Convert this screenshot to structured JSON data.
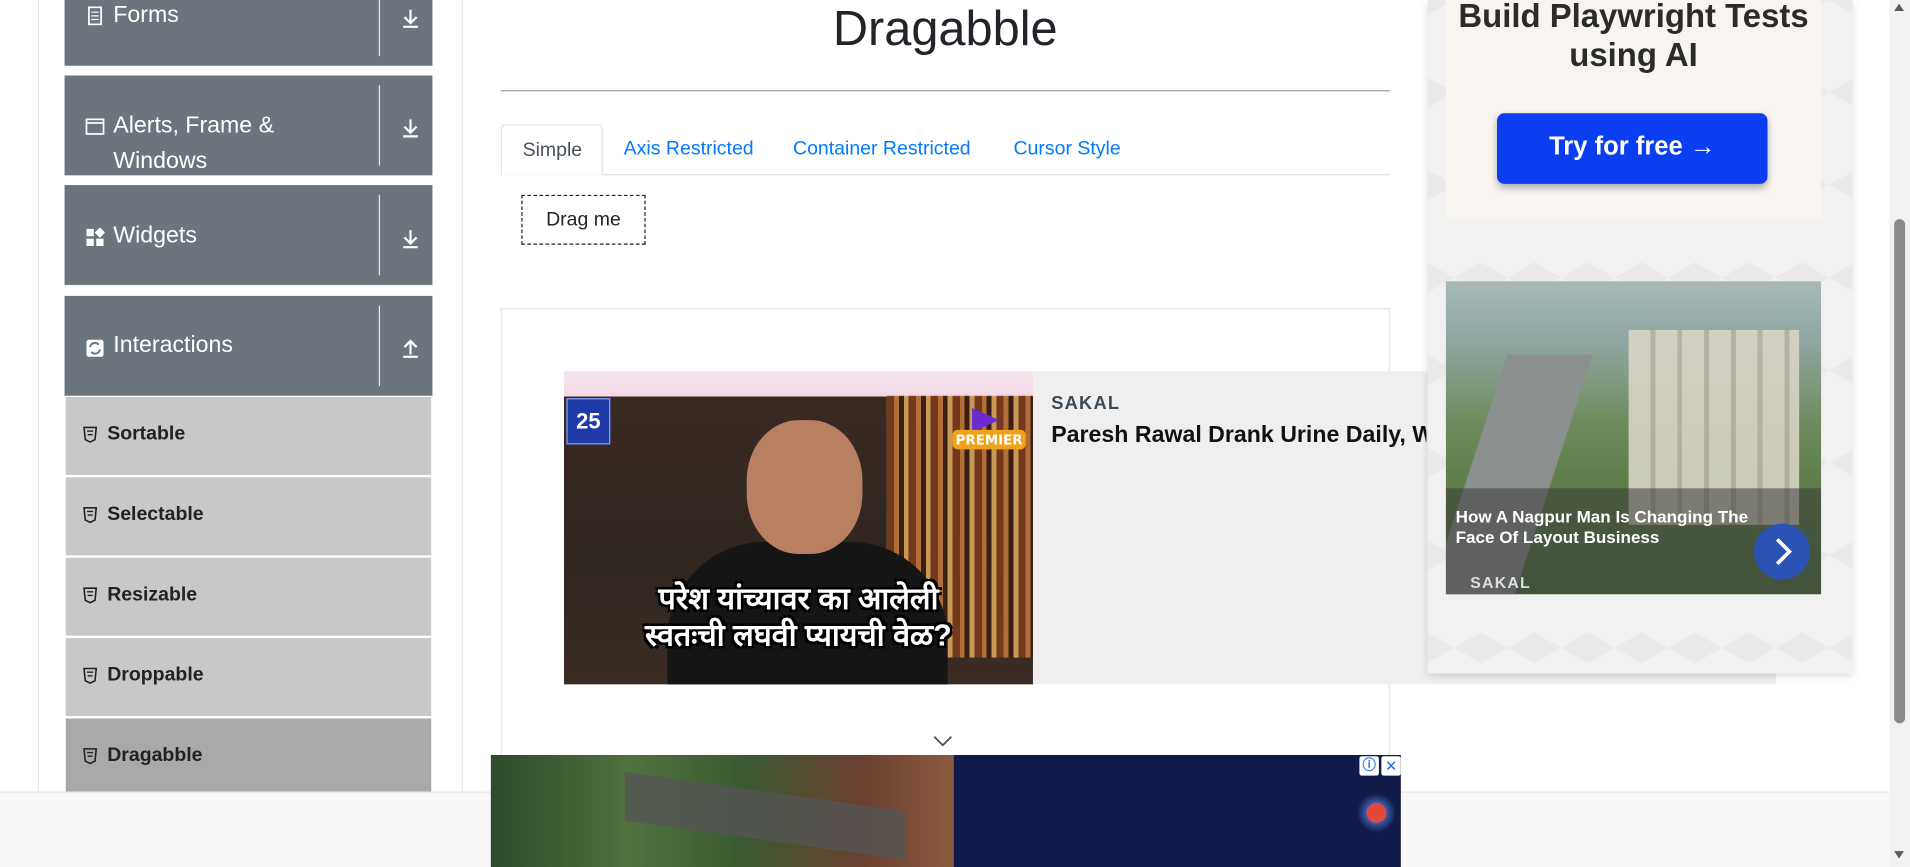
{
  "sidebar": {
    "groups": [
      {
        "label": "Forms",
        "icon": "form-icon",
        "arrow": "download-arrow-icon"
      },
      {
        "label": "Alerts, Frame & Windows",
        "icon": "window-icon",
        "arrow": "download-arrow-icon"
      },
      {
        "label": "Widgets",
        "icon": "widgets-icon",
        "arrow": "download-arrow-icon"
      },
      {
        "label": "Interactions",
        "icon": "interactions-icon",
        "arrow": "upload-arrow-icon"
      }
    ],
    "items": [
      {
        "label": "Sortable"
      },
      {
        "label": "Selectable"
      },
      {
        "label": "Resizable"
      },
      {
        "label": "Droppable"
      },
      {
        "label": "Dragabble",
        "active": true
      }
    ]
  },
  "main": {
    "title": "Dragabble",
    "tabs": [
      {
        "label": "Simple",
        "active": true
      },
      {
        "label": "Axis Restricted"
      },
      {
        "label": "Container Restricted"
      },
      {
        "label": "Cursor Style"
      }
    ],
    "drag_box": "Drag me"
  },
  "native_ad": {
    "source": "SAKAL",
    "headline": "Paresh Rawal Drank Urine Daily, Wh",
    "image_caption_line1": "परेश यांच्यावर का आलेली",
    "image_caption_line2": "स्वतःची लघवी प्यायची वेळ?",
    "badge": "25",
    "badge_premier": "PREMIER"
  },
  "right_ad": {
    "title": "Build Playwright Tests using AI",
    "button": "Try for free →",
    "story_title": "How A Nagpur Man Is Changing The Face Of Layout Business",
    "story_source": "SAKAL"
  },
  "bottom_ad": {
    "info": "ⓘ",
    "close": "✕"
  },
  "colors": {
    "sidebar_group": "#6c757d",
    "sidebar_item": "#c8c8c8",
    "tab_link": "#007bff",
    "cta_blue": "#0a3ef0"
  }
}
